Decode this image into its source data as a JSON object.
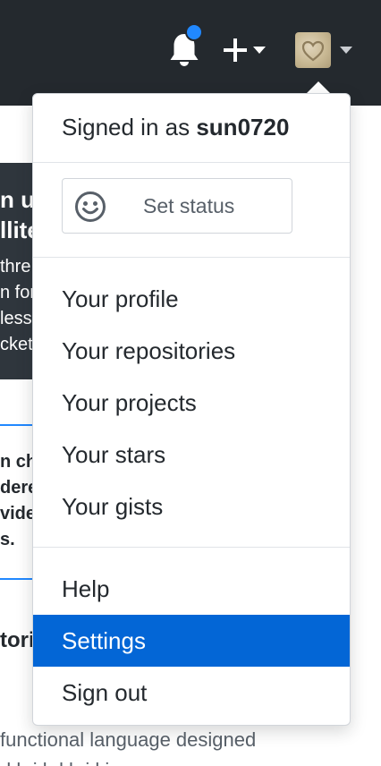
{
  "header": {
    "notifications_icon": "bell-icon",
    "new_icon": "plus-icon",
    "avatar_icon": "heart-in-sand-avatar",
    "colors": {
      "header_bg": "#24292e",
      "unread_dot": "#2188ff"
    }
  },
  "background": {
    "hero_line1": "n u",
    "hero_line2": "llite",
    "hero_lines": "thre\nn for\nless\ncket",
    "card_text": "n ch\ndere\nvide\ns.",
    "section_heading": "tori",
    "description_line1": "functional language designed",
    "description_line2": "d b i l d b i l i"
  },
  "dropdown": {
    "signed_in_prefix": "Signed in as",
    "username": "sun0720",
    "set_status_label": "Set status",
    "status_icon": "smiley-icon",
    "primary_items": [
      {
        "label": "Your profile"
      },
      {
        "label": "Your repositories"
      },
      {
        "label": "Your projects"
      },
      {
        "label": "Your stars"
      },
      {
        "label": "Your gists"
      }
    ],
    "secondary_items": [
      {
        "label": "Help"
      },
      {
        "label": "Settings"
      },
      {
        "label": "Sign out"
      }
    ],
    "active_item": "Settings",
    "colors": {
      "active_bg": "#0366d6",
      "active_text": "#ffffff"
    }
  }
}
